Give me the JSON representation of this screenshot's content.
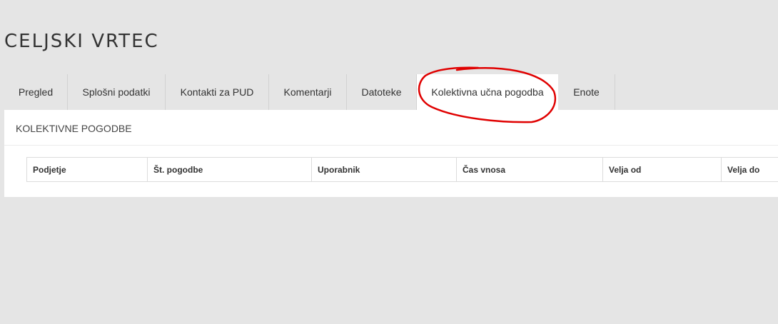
{
  "header": {
    "title": "CELJSKI VRTEC"
  },
  "tabs": [
    {
      "label": "Pregled",
      "active": false
    },
    {
      "label": "Splošni podatki",
      "active": false
    },
    {
      "label": "Kontakti za PUD",
      "active": false
    },
    {
      "label": "Komentarji",
      "active": false
    },
    {
      "label": "Datoteke",
      "active": false
    },
    {
      "label": "Kolektivna učna pogodba",
      "active": true
    },
    {
      "label": "Enote",
      "active": false
    }
  ],
  "panel": {
    "title": "KOLEKTIVNE POGODBE",
    "columns": [
      "Podjetje",
      "Št. pogodbe",
      "Uporabnik",
      "Čas vnosa",
      "Velja od",
      "Velja do"
    ],
    "rows": []
  },
  "annotation": {
    "color": "#e00000",
    "shape": "ellipse",
    "target": "Kolektivna učna pogodba"
  }
}
